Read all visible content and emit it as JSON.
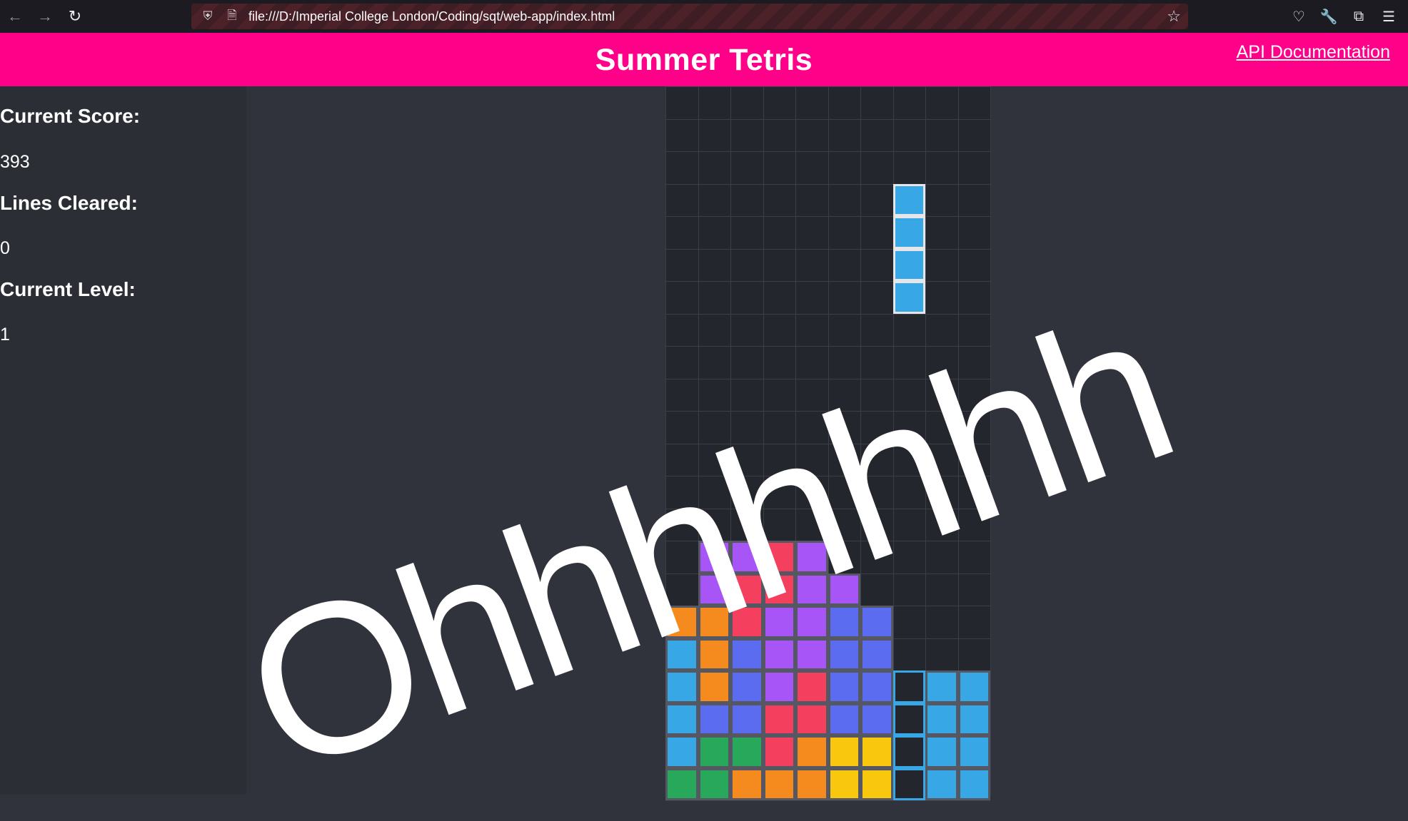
{
  "browser": {
    "url": "file:///D:/Imperial College London/Coding/sqt/web-app/index.html",
    "icons": [
      "back-icon",
      "forward-icon",
      "reload-icon",
      "shield-icon",
      "page-icon",
      "star-icon",
      "pocket-icon",
      "wrench-icon",
      "extensions-icon",
      "menu-icon"
    ]
  },
  "header": {
    "title": "Summer Tetris",
    "api_link": "API Documentation",
    "color": "#ff0088"
  },
  "stats": {
    "score_label": "Current Score:",
    "score_value": "393",
    "lines_label": "Lines Cleared:",
    "lines_value": "0",
    "level_label": "Current Level:",
    "level_value": "1"
  },
  "overlay_text": "Ohhhhhhh",
  "board": {
    "cols": 10,
    "visible_rows": 22,
    "palette": {
      "O": "#f58a1f",
      "C": "#38a7e6",
      "P": "#a855f7",
      "R": "#f43f5e",
      "B": "#5b6cf0",
      "G": "#27a85a",
      "Y": "#f9c80e"
    },
    "rows": [
      "..........",
      "..........",
      "..........",
      ".......C..",
      ".......C..",
      ".......C..",
      ".......C..",
      "..........",
      "..........",
      "..........",
      "..........",
      "..........",
      "..........",
      "..........",
      ".PPRP.....",
      ".PRRPP....",
      "OORPPBB...",
      "COBPPBB...",
      "COBPRBBXCC",
      "CBBRRBBXCC",
      "CGGROYYXCC",
      "GGOOOYYXCC"
    ],
    "active_column": 7,
    "active_rows": [
      3,
      4,
      5,
      6
    ],
    "outline_cells": [
      [
        18,
        7
      ],
      [
        19,
        7
      ],
      [
        20,
        7
      ],
      [
        21,
        7
      ]
    ]
  }
}
